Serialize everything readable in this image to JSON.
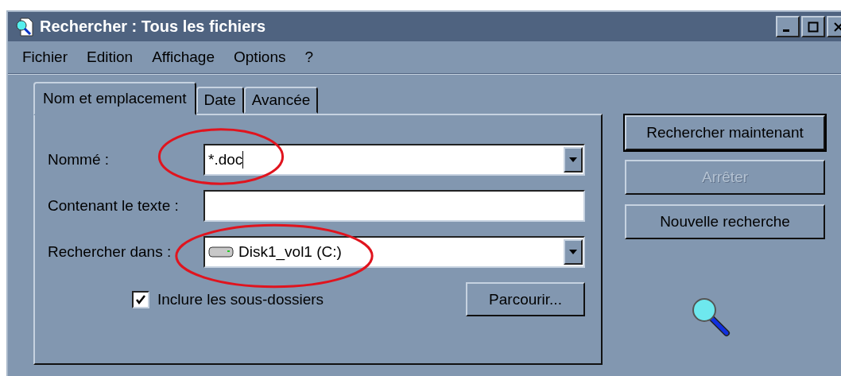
{
  "window": {
    "title": "Rechercher : Tous les fichiers"
  },
  "menu": [
    "Fichier",
    "Edition",
    "Affichage",
    "Options",
    "?"
  ],
  "tabs": [
    {
      "label": "Nom et emplacement",
      "selected": true
    },
    {
      "label": "Date",
      "selected": false
    },
    {
      "label": "Avancée",
      "selected": false
    }
  ],
  "fields": [
    {
      "kind": "combo",
      "label": "Nommé :",
      "value": "*.doc",
      "circled": true
    },
    {
      "kind": "text",
      "label": "Contenant le texte :",
      "circled": false
    },
    {
      "kind": "drive",
      "label": "Rechercher dans :",
      "value": "Disk1_vol1 (C:)",
      "circled": true
    }
  ],
  "subfolders": {
    "label": "Inclure les sous-dossiers",
    "checked": true
  },
  "browse_button": "Parcourir...",
  "actions": [
    {
      "label": "Rechercher maintenant",
      "disabled": false,
      "default": true
    },
    {
      "label": "Arrêter",
      "disabled": true,
      "default": false
    },
    {
      "label": "Nouvelle recherche",
      "disabled": false,
      "default": false
    }
  ]
}
